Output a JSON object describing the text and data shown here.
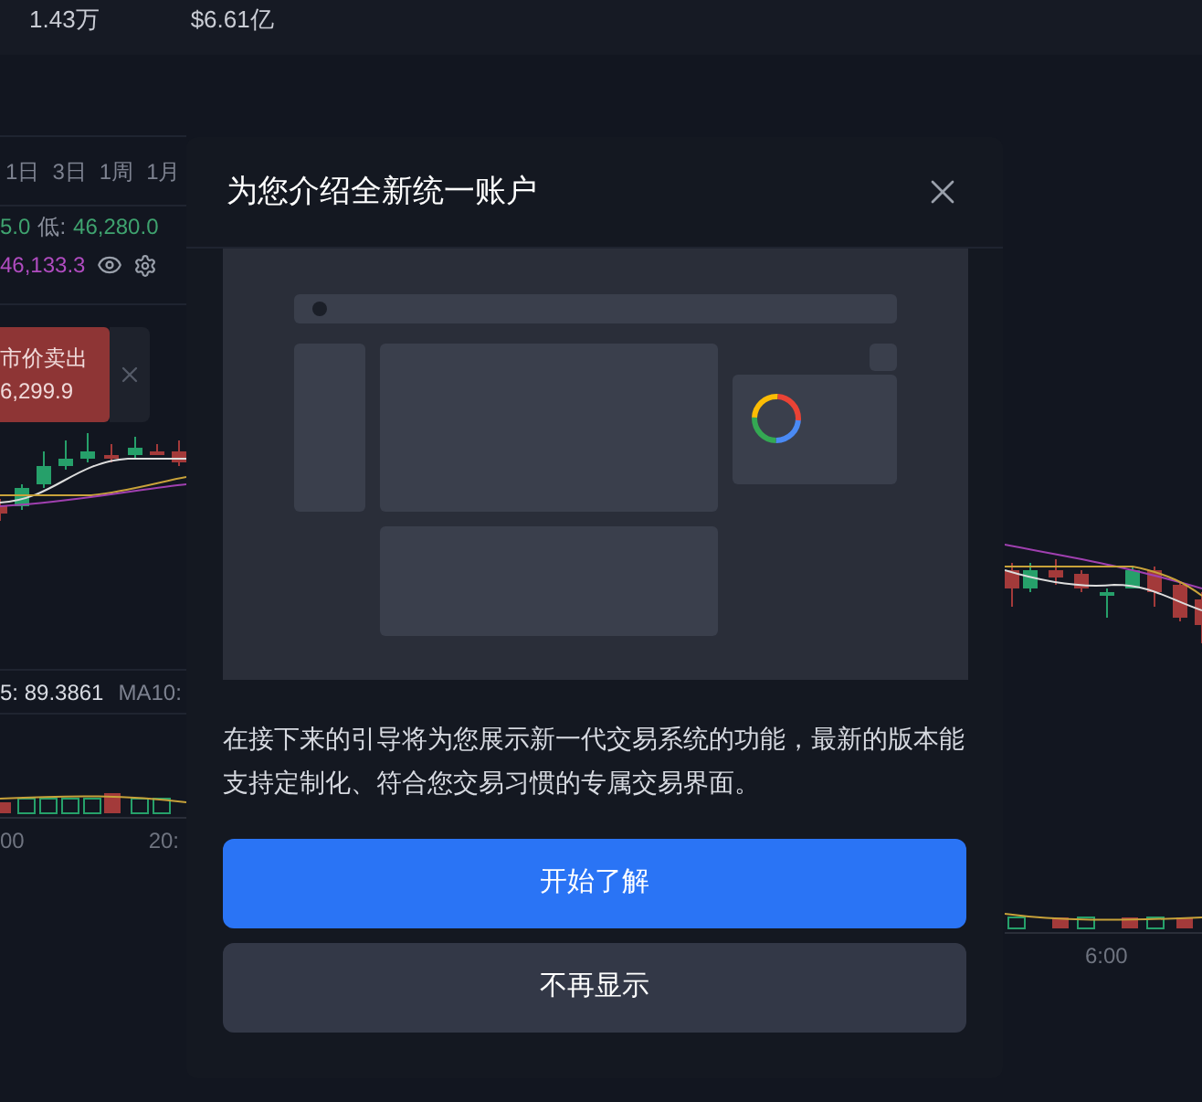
{
  "top_stats": [
    {
      "value": "1.43万"
    },
    {
      "value": "$6.61亿"
    }
  ],
  "timeframe_tabs": [
    {
      "label": "1日",
      "selected": false
    },
    {
      "label": "3日",
      "selected": false
    },
    {
      "label": "1周",
      "selected": false
    },
    {
      "label": "1月",
      "selected": false
    }
  ],
  "price_stats": [
    {
      "text": "5.0",
      "kind": "value"
    },
    {
      "text": "低:",
      "kind": "label"
    },
    {
      "text": "46,280.0",
      "kind": "value"
    }
  ],
  "ma_value": "46,133.3",
  "sell_order": {
    "title": "市价卖出",
    "price": "6,299.9"
  },
  "indicator": {
    "reading": "5: 89.3861",
    "label": "MA10:"
  },
  "left_time_axis": [
    "00",
    "20:"
  ],
  "right_time_axis": [
    "6:00"
  ],
  "dialog": {
    "title": "为您介绍全新统一账户",
    "body": "在接下来的引导将为您展示新一代交易系统的功能，最新的版本能支持定制化、符合您交易习惯的专属交易界面。",
    "buttons": [
      {
        "label": "开始了解",
        "kind": "primary"
      },
      {
        "label": "不再显示",
        "kind": "secondary"
      }
    ]
  }
}
